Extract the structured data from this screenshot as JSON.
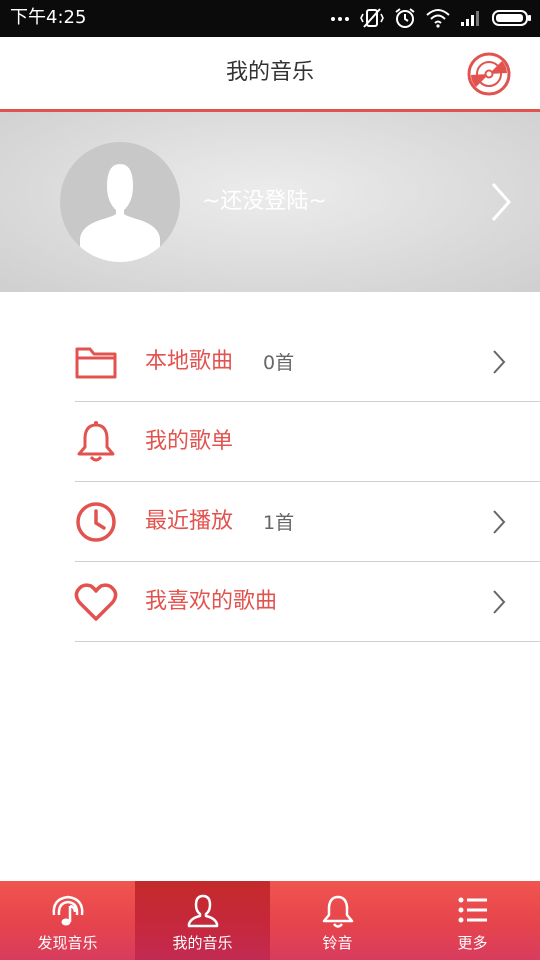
{
  "status_bar": {
    "time": "下午4:25"
  },
  "header": {
    "title": "我的音乐",
    "action_icon": "disc-icon"
  },
  "profile": {
    "login_text": "~还没登陆~",
    "avatar_icon": "user-silhouette-icon"
  },
  "menu": {
    "items": [
      {
        "label": "本地歌曲",
        "count": "0首",
        "icon": "folder-icon",
        "has_chevron": true
      },
      {
        "label": "我的歌单",
        "count": "",
        "icon": "bell-icon",
        "has_chevron": false
      },
      {
        "label": "最近播放",
        "count": "1首",
        "icon": "clock-icon",
        "has_chevron": true
      },
      {
        "label": "我喜欢的歌曲",
        "count": "",
        "icon": "heart-icon",
        "has_chevron": true
      }
    ]
  },
  "bottom_nav": {
    "items": [
      {
        "label": "发现音乐",
        "icon": "music-note-signal-icon",
        "active": false
      },
      {
        "label": "我的音乐",
        "icon": "user-icon",
        "active": true
      },
      {
        "label": "铃音",
        "icon": "bell-icon",
        "active": false
      },
      {
        "label": "更多",
        "icon": "list-icon",
        "active": false
      }
    ]
  },
  "colors": {
    "accent": "#e2534f",
    "status_bar": "#0b0b0b",
    "nav_active": "#c42a2a"
  }
}
